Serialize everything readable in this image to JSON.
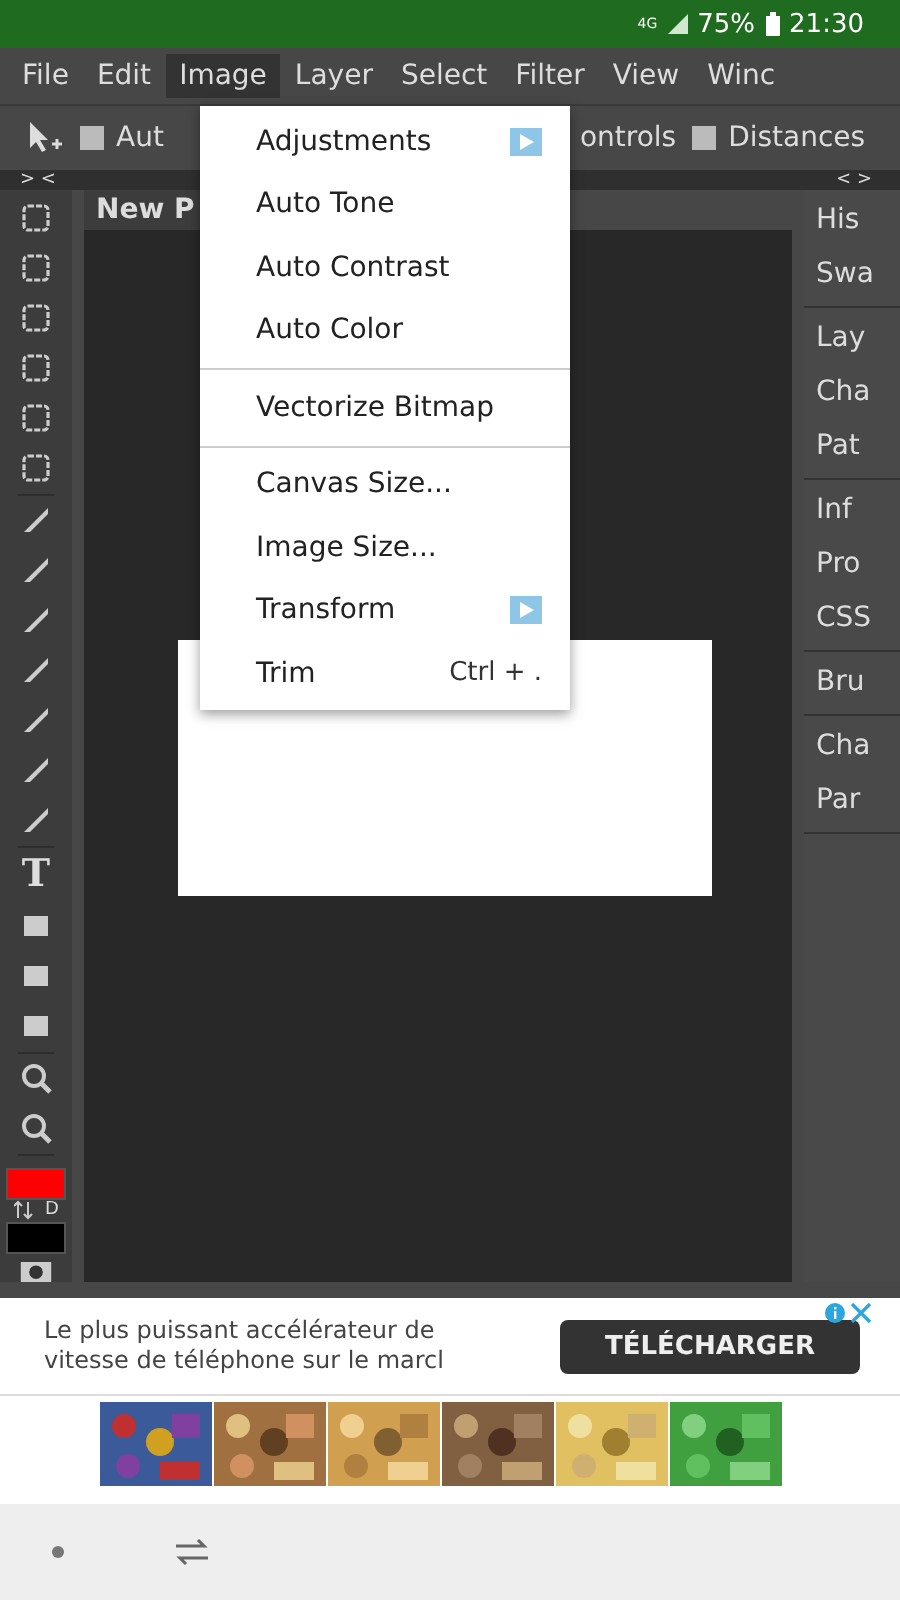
{
  "status_bar": {
    "network": "4G",
    "battery": "75%",
    "time": "21:30"
  },
  "menu_bar": [
    {
      "label": "File",
      "selected": false
    },
    {
      "label": "Edit",
      "selected": false
    },
    {
      "label": "Image",
      "selected": true
    },
    {
      "label": "Layer",
      "selected": false
    },
    {
      "label": "Select",
      "selected": false
    },
    {
      "label": "Filter",
      "selected": false
    },
    {
      "label": "View",
      "selected": false
    },
    {
      "label": "Winc",
      "selected": false
    }
  ],
  "options_bar": [
    {
      "label": "Aut",
      "checked": false
    },
    {
      "label": "ontrols",
      "kind": "text"
    },
    {
      "label": "Distances",
      "checked": false
    }
  ],
  "panel_toggles": {
    "left": "> <",
    "right": "< >"
  },
  "document_tab": "New P",
  "tools": {
    "text_glyph": "T",
    "default_colors": "D",
    "swatches": [
      {
        "color": "#ff0000"
      },
      {
        "color": "#000000"
      }
    ]
  },
  "image_menu": [
    {
      "kind": "item",
      "label": "Adjustments",
      "submenu": true
    },
    {
      "kind": "item",
      "label": "Auto Tone"
    },
    {
      "kind": "item",
      "label": "Auto Contrast"
    },
    {
      "kind": "item",
      "label": "Auto Color"
    },
    {
      "kind": "separator"
    },
    {
      "kind": "item",
      "label": "Vectorize Bitmap"
    },
    {
      "kind": "separator"
    },
    {
      "kind": "item",
      "label": "Canvas Size..."
    },
    {
      "kind": "item",
      "label": "Image Size..."
    },
    {
      "kind": "item",
      "label": "Transform",
      "submenu": true
    },
    {
      "kind": "item",
      "label": "Trim",
      "shortcut": "Ctrl + ."
    }
  ],
  "right_panel": [
    [
      "His",
      "Swa"
    ],
    [
      "Lay",
      "Cha",
      "Pat"
    ],
    [
      "Inf",
      "Pro",
      "CSS"
    ],
    [
      "Bru"
    ],
    [
      "Cha",
      "Par"
    ]
  ],
  "ad": {
    "text": "Le plus puissant accélérateur de vitesse de téléphone sur le marcl",
    "button": "TÉLÉCHARGER"
  },
  "thumbnails": [
    {
      "kind": "picture"
    },
    {
      "kind": "picture"
    },
    {
      "kind": "picture"
    },
    {
      "kind": "picture"
    },
    {
      "kind": "picture"
    },
    {
      "kind": "picture"
    }
  ]
}
